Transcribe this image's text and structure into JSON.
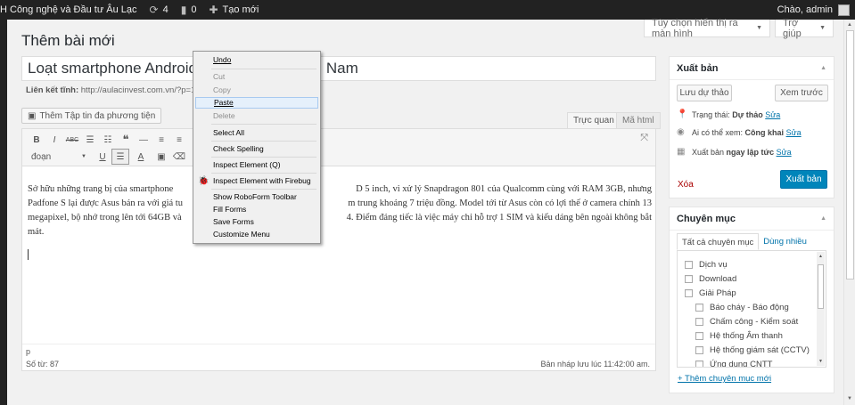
{
  "adminbar": {
    "site_name": "H Công nghệ và Đầu tư Âu Lạc",
    "updates_count": "4",
    "comments_count": "0",
    "new_label": "Tạo mới",
    "greeting": "Chào, admin"
  },
  "top_tabs": {
    "screen_options": "Tùy chọn hiển thị ra màn hình",
    "help": "Trợ giúp"
  },
  "page_title": "Thêm bài mới",
  "post_title_left": "Loạt smartphone Android tá",
  "post_title_right": "Nam",
  "permalink": {
    "label": "Liên kết tĩnh:",
    "url": "http://aulacinvest.com.vn/?p=144"
  },
  "add_media_label": "Thêm Tập tin đa phương tiện",
  "editor_tabs": {
    "visual": "Trực quan",
    "html": "Mã html"
  },
  "toolbar": {
    "row1": [
      "B",
      "I",
      "ABC",
      "☰",
      "☷",
      "❝",
      "—",
      "≡",
      "≡"
    ],
    "format_value": "đoạn",
    "row2": [
      "U",
      "☰",
      "A",
      "▣",
      "⌫"
    ]
  },
  "content_left": [
    "Sở hữu những trang bị của smartphone",
    "Padfone S lại được Asus bán ra với giá tu",
    "megapixel, bộ nhớ trong lên tới 64GB và",
    "mát."
  ],
  "content_right": [
    "D 5 inch, vi xử lý Snapdragon 801 của Qualcomm cùng với RAM 3GB, nhưng",
    "m trung khoảng 7 triệu đồng. Model tới từ Asus còn có lợi thế ở camera chính 13",
    "4. Điểm đáng tiếc là việc máy chỉ hỗ trợ 1 SIM và kiểu dáng bên ngoài không bắt"
  ],
  "status": {
    "path": "p",
    "word_count": "Số từ: 87",
    "draft_saved": "Bản nháp lưu lúc 11:42:00 am."
  },
  "context_menu": [
    {
      "label": "Undo",
      "disabled": false
    },
    {
      "label": "Cut",
      "disabled": true
    },
    {
      "label": "Copy",
      "disabled": true
    },
    {
      "label": "Paste",
      "disabled": false,
      "highlighted": true
    },
    {
      "label": "Delete",
      "disabled": true
    },
    {
      "label": "Select All",
      "disabled": false
    },
    {
      "label": "Check Spelling",
      "disabled": false
    },
    {
      "label": "Inspect Element (Q)",
      "disabled": false
    },
    {
      "label": "Inspect Element with Firebug",
      "disabled": false,
      "icon": "firebug-icon"
    },
    {
      "label": "Show RoboForm Toolbar",
      "disabled": false
    },
    {
      "label": "Fill Forms",
      "disabled": false
    },
    {
      "label": "Save Forms",
      "disabled": false
    },
    {
      "label": "Customize Menu",
      "disabled": false
    }
  ],
  "publish_box": {
    "title": "Xuất bản",
    "save_draft": "Lưu dự thảo",
    "preview": "Xem trước",
    "status_label": "Trạng thái:",
    "status_value": "Dự thảo",
    "visibility_label": "Ai có thể xem:",
    "visibility_value": "Công khai",
    "schedule_label": "Xuất bản",
    "schedule_value": "ngay lập tức",
    "edit_link": "Sửa",
    "trash": "Xóa",
    "publish": "Xuất bản"
  },
  "category_box": {
    "title": "Chuyên mục",
    "tab_all": "Tất cả chuyên mục",
    "tab_popular": "Dùng nhiều",
    "items": [
      {
        "label": "Dịch vụ",
        "level": 0
      },
      {
        "label": "Download",
        "level": 0
      },
      {
        "label": "Giải Pháp",
        "level": 0
      },
      {
        "label": "Báo cháy - Báo động",
        "level": 1
      },
      {
        "label": "Chấm công - Kiểm soát",
        "level": 1
      },
      {
        "label": "Hệ thống Âm thanh",
        "level": 1
      },
      {
        "label": "Hệ thống giám sát (CCTV)",
        "level": 1
      },
      {
        "label": "Ứng dụng CNTT",
        "level": 1
      }
    ],
    "add_new": "+ Thêm chuyên mục mới"
  },
  "colors": {
    "admin_bar": "#222222",
    "primary_button": "#0085ba",
    "link": "#0073aa",
    "trash": "#aa0000"
  }
}
